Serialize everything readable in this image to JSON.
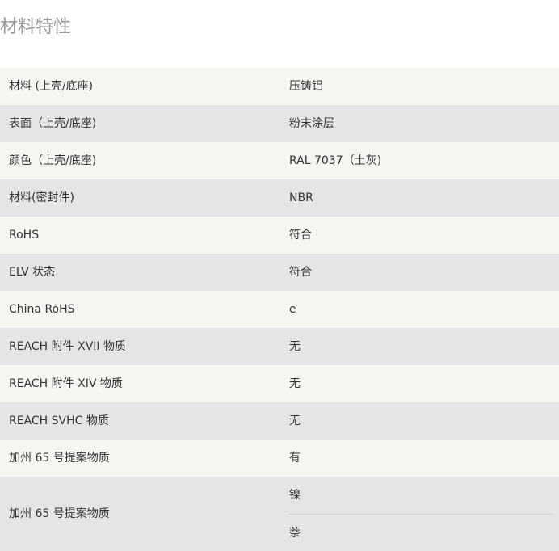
{
  "section": {
    "title": "材料特性"
  },
  "rows": [
    {
      "key": "材料 (上壳/底座)",
      "value": "压铸铝"
    },
    {
      "key": "表面（上壳/底座)",
      "value": "粉末涂层"
    },
    {
      "key": "颜色（上壳/底座)",
      "value": "RAL 7037（土灰)"
    },
    {
      "key": "材料(密封件)",
      "value": "NBR"
    },
    {
      "key": "RoHS",
      "value": "符合"
    },
    {
      "key": "ELV 状态",
      "value": "符合"
    },
    {
      "key": "China RoHS",
      "value": "e"
    },
    {
      "key": "REACH 附件 XVII 物质",
      "value": "无"
    },
    {
      "key": "REACH 附件 XIV 物质",
      "value": "无"
    },
    {
      "key": "REACH SVHC 物质",
      "value": "无"
    },
    {
      "key": "加州 65 号提案物质",
      "value": "有"
    },
    {
      "key": "加州 65 号提案物质",
      "values": [
        "镍",
        "萘"
      ]
    }
  ]
}
